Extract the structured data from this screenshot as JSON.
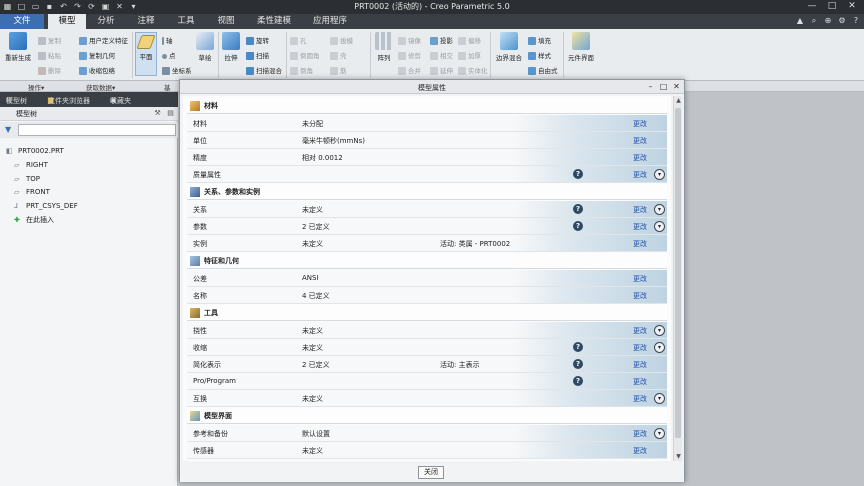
{
  "window": {
    "title": "PRT0002 (活动的) - Creo Parametric 5.0"
  },
  "tabs": [
    "文件",
    "模型",
    "分析",
    "注释",
    "工具",
    "视图",
    "柔性建模",
    "应用程序"
  ],
  "ribbon": {
    "regen": "重新生成",
    "copy": "复制",
    "paste": "粘贴",
    "delete": "删除",
    "user_feature": "用户定义特征",
    "copy_geometry": "复制几何",
    "shrinkwrap": "收缩包络",
    "plane": "平面",
    "axis": "轴",
    "point": "点",
    "csys": "坐标系",
    "sketch": "草绘",
    "extrude": "拉伸",
    "revolve": "旋转",
    "sweep": "扫描",
    "swept_blend": "扫描混合",
    "pattern": "阵列",
    "project": "投影",
    "boundary_blend": "边界混合",
    "fill": "填充",
    "style": "样式",
    "freestyle": "自由式",
    "component_interface": "元件界面",
    "dim_items": [
      "孔",
      "倒圆角",
      "倒角",
      "拔模",
      "壳",
      "筋",
      "镜像",
      "修剪",
      "合并",
      "相交",
      "延伸",
      "偏移",
      "加厚",
      "实体化"
    ]
  },
  "groups": {
    "operations": "操作▾",
    "get_data": "获取数据▾",
    "datum": "基"
  },
  "left_panel": {
    "tabs": [
      "模型树",
      "文件夹浏览器",
      "收藏夹"
    ],
    "header": "模型树",
    "tree": [
      {
        "label": "PRT0002.PRT",
        "icon": "part-icon"
      },
      {
        "label": "RIGHT",
        "icon": "datum-plane-icon"
      },
      {
        "label": "TOP",
        "icon": "datum-plane-icon"
      },
      {
        "label": "FRONT",
        "icon": "datum-plane-icon"
      },
      {
        "label": "PRT_CSYS_DEF",
        "icon": "csys-icon"
      },
      {
        "label": "在此插入",
        "icon": "insert-here-icon"
      }
    ]
  },
  "dialog": {
    "title": "模型属性",
    "change_label": "更改",
    "close_label": "关闭",
    "sections": [
      {
        "title": "材料",
        "rows": [
          {
            "name": "材料",
            "value": "未分配",
            "active": "",
            "info": false,
            "expand": false
          },
          {
            "name": "单位",
            "value": "毫米牛顿秒(mmNs)",
            "active": "",
            "info": false,
            "expand": false
          },
          {
            "name": "精度",
            "value": "相对 0.0012",
            "active": "",
            "info": false,
            "expand": false
          },
          {
            "name": "质量属性",
            "value": "",
            "active": "",
            "info": true,
            "expand": true
          }
        ]
      },
      {
        "title": "关系、参数和实例",
        "rows": [
          {
            "name": "关系",
            "value": "未定义",
            "active": "",
            "info": true,
            "expand": true
          },
          {
            "name": "参数",
            "value": "2 已定义",
            "active": "",
            "info": true,
            "expand": true
          },
          {
            "name": "实例",
            "value": "未定义",
            "active": "活动: 类属 - PRT0002",
            "info": false,
            "expand": false
          }
        ]
      },
      {
        "title": "特征和几何",
        "rows": [
          {
            "name": "公差",
            "value": "ANSI",
            "active": "",
            "info": false,
            "expand": false
          },
          {
            "name": "名称",
            "value": "4 已定义",
            "active": "",
            "info": false,
            "expand": false
          }
        ]
      },
      {
        "title": "工具",
        "rows": [
          {
            "name": "挠性",
            "value": "未定义",
            "active": "",
            "info": false,
            "expand": true
          },
          {
            "name": "收缩",
            "value": "未定义",
            "active": "",
            "info": true,
            "expand": true
          },
          {
            "name": "简化表示",
            "value": "2 已定义",
            "active": "活动: 主表示",
            "info": true,
            "expand": false
          },
          {
            "name": "Pro/Program",
            "value": "",
            "active": "",
            "info": true,
            "expand": false
          },
          {
            "name": "互换",
            "value": "未定义",
            "active": "",
            "info": false,
            "expand": true
          }
        ]
      },
      {
        "title": "模型界面",
        "rows": [
          {
            "name": "参考和备份",
            "value": "默认设置",
            "active": "",
            "info": false,
            "expand": true
          },
          {
            "name": "传感器",
            "value": "未定义",
            "active": "",
            "info": false,
            "expand": false
          }
        ]
      }
    ]
  },
  "colors": {
    "file_tab": "#3c6fb0",
    "info_icon": "#2e4a63",
    "link": "#1f4fa8"
  }
}
